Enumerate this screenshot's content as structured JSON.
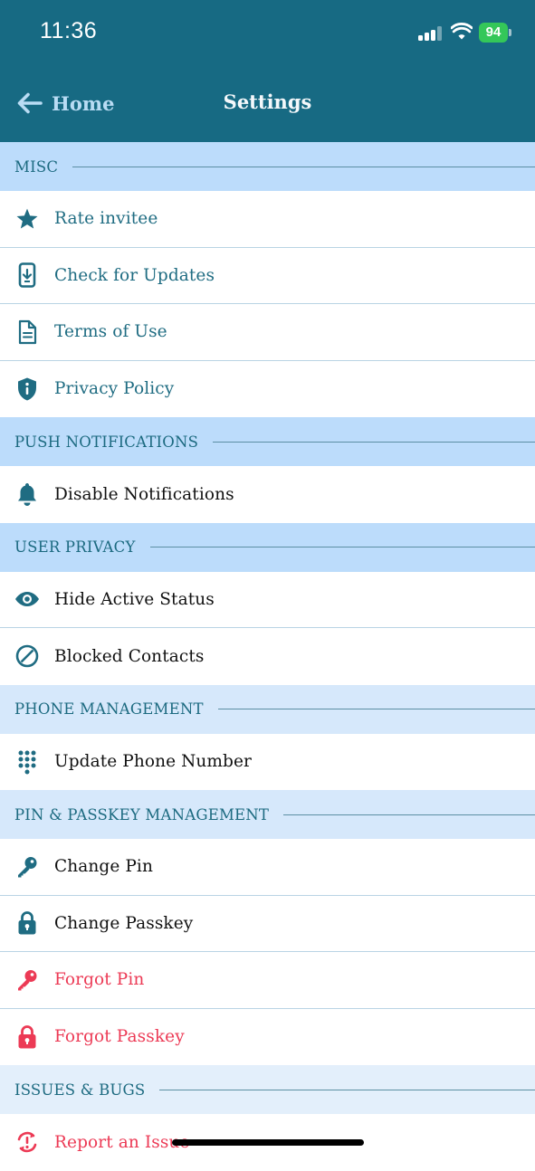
{
  "status_bar": {
    "time": "11:36",
    "battery": "94"
  },
  "header": {
    "back_label": "Home",
    "title": "Settings"
  },
  "sections": [
    {
      "title": "MISC",
      "items": [
        {
          "label": "Rate invitee",
          "icon": "star-icon"
        },
        {
          "label": "Check for Updates",
          "icon": "phone-download-icon"
        },
        {
          "label": "Terms of Use",
          "icon": "document-icon"
        },
        {
          "label": "Privacy Policy",
          "icon": "shield-info-icon"
        }
      ]
    },
    {
      "title": "PUSH NOTIFICATIONS",
      "items": [
        {
          "label": "Disable Notifications",
          "icon": "bell-icon"
        }
      ]
    },
    {
      "title": "USER PRIVACY",
      "items": [
        {
          "label": "Hide Active Status",
          "icon": "eye-icon"
        },
        {
          "label": "Blocked Contacts",
          "icon": "block-icon"
        }
      ]
    },
    {
      "title": "PHONE MANAGEMENT",
      "items": [
        {
          "label": "Update Phone Number",
          "icon": "dialpad-icon"
        }
      ]
    },
    {
      "title": "PIN & PASSKEY MANAGEMENT",
      "items": [
        {
          "label": "Change Pin",
          "icon": "key-icon"
        },
        {
          "label": "Change Passkey",
          "icon": "lock-icon"
        },
        {
          "label": "Forgot Pin",
          "icon": "key-icon"
        },
        {
          "label": "Forgot Passkey",
          "icon": "lock-icon"
        }
      ]
    },
    {
      "title": "ISSUES & BUGS",
      "items": [
        {
          "label": "Report an Issue",
          "icon": "report-issue-icon"
        }
      ]
    }
  ],
  "colors": {
    "header_bg": "#176a83",
    "teal": "#1f6c82",
    "danger": "#ec3a55",
    "section_bg": "#bcdcfb",
    "battery": "#34c759"
  }
}
